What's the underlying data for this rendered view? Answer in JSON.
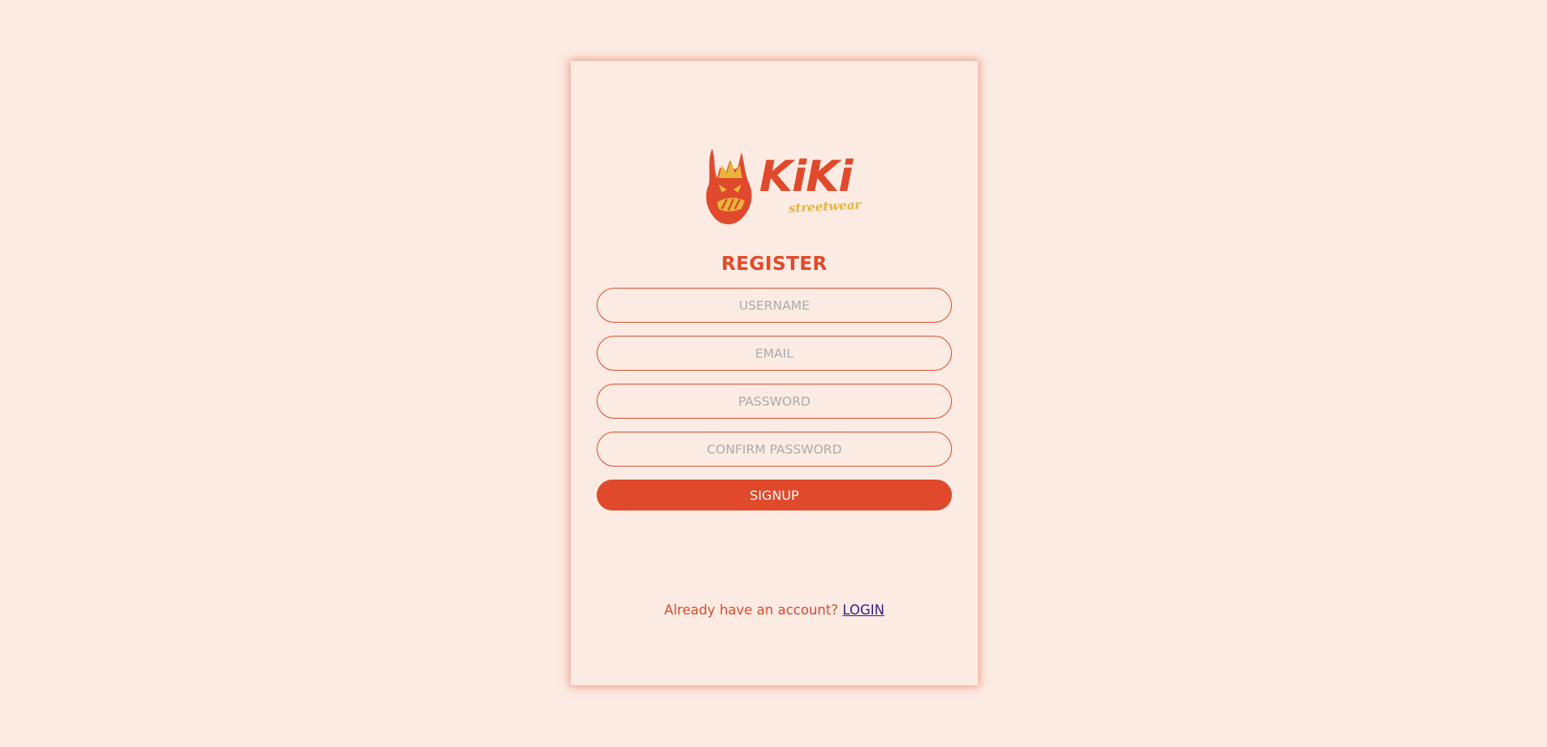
{
  "brand": {
    "name": "KiKi",
    "tagline": "streetwear",
    "colors": {
      "primary": "#e0492b",
      "accent": "#e8b43c",
      "background": "#fcebe3",
      "link": "#3a1c8c"
    }
  },
  "form": {
    "title": "REGISTER",
    "fields": {
      "username": {
        "placeholder": "USERNAME",
        "value": ""
      },
      "email": {
        "placeholder": "EMAIL",
        "value": ""
      },
      "password": {
        "placeholder": "PASSWORD",
        "value": ""
      },
      "confirm_password": {
        "placeholder": "CONFIRM PASSWORD",
        "value": ""
      }
    },
    "submit_label": "SIGNUP"
  },
  "footer": {
    "prompt": "Already have an account?",
    "login_label": "LOGIN"
  }
}
